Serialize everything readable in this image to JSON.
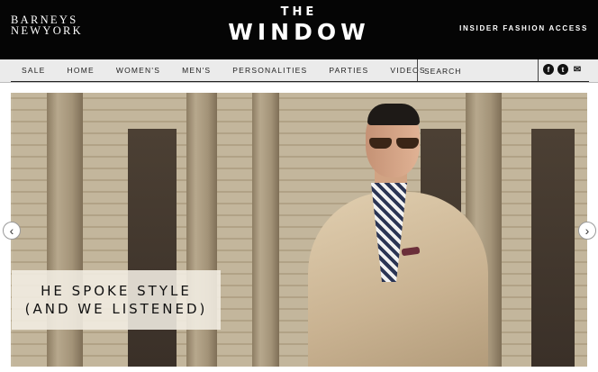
{
  "header": {
    "logo_line1": "BARNEYS",
    "logo_line2": "NEWYORK",
    "masthead_small": "THE",
    "masthead_big": "WINDOW",
    "tagline": "INSIDER FASHION ACCESS"
  },
  "nav": {
    "items": [
      "SALE",
      "HOME",
      "WOMEN'S",
      "MEN'S",
      "PERSONALITIES",
      "PARTIES",
      "VIDEOS"
    ],
    "search_placeholder": "SEARCH"
  },
  "social": {
    "facebook": "f",
    "twitter": "t",
    "mail": "✉"
  },
  "hero": {
    "caption_line1": "HE SPOKE STYLE",
    "caption_line2": "(AND WE LISTENED)",
    "prev_label": "‹",
    "next_label": "›"
  },
  "colors": {
    "header_bg": "#050505",
    "nav_bg": "#ebebeb"
  }
}
